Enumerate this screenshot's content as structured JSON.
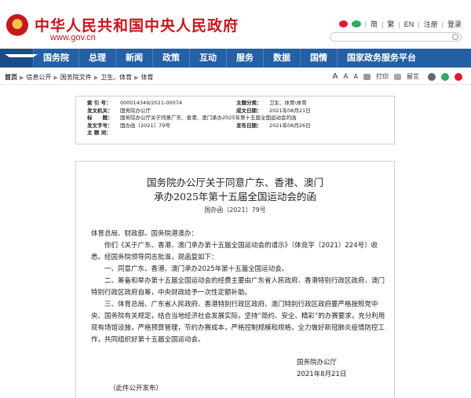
{
  "header": {
    "site_title": "中华人民共和国中央人民政府",
    "site_url": "www.gov.cn",
    "top_links": [
      "简",
      "繁",
      "EN",
      "注册",
      "登录"
    ]
  },
  "nav": {
    "items": [
      "国务院",
      "总理",
      "新闻",
      "政策",
      "互动",
      "服务",
      "数据",
      "国情",
      "国家政务服务平台"
    ]
  },
  "breadcrumb": {
    "items": [
      "首页",
      "信息公开",
      "国务院文件",
      "卫生、体育",
      "体育"
    ],
    "tools": [
      "A",
      "A",
      "A",
      "打印",
      "留言"
    ]
  },
  "meta": {
    "index_label": "索 引 号：",
    "index_value": "000014349/2021-00074",
    "category_label": "主题分类：",
    "category_value": "卫生、体育\\体育",
    "issuer_label": "发文机关：",
    "issuer_value": "国务院办公厅",
    "created_label": "成文日期：",
    "created_value": "2021年08月21日",
    "title_label": "标　　题：",
    "title_value": "国务院办公厅关于同意广东、香港、澳门承办2025年第十五届全国运动会的函",
    "docno_label": "发文字号：",
    "docno_value": "国办函〔2021〕79号",
    "published_label": "发布日期：",
    "published_value": "2021年08月26日",
    "keyword_label": "主 题 词："
  },
  "doc": {
    "title_line1": "国务院办公厅关于同意广东、香港、澳门",
    "title_line2": "承办2025年第十五届全国运动会的函",
    "doc_no": "国办函〔2021〕79号",
    "salutation": "体育总局、财政部、国务院港澳办：",
    "p1": "你们《关于广东、香港、澳门承办第十五届全国运动会的请示》（体竞字〔2021〕224号）收悉。经国务院领导同志批准，现函复如下：",
    "p2": "一、同意广东、香港、澳门承办2025年第十五届全国运动会。",
    "p3": "二、筹备和举办第十五届全国运动会的经费主要由广东省人民政府、香港特别行政区政府、澳门特别行政区政府自筹，中央财政给予一次性定额补助。",
    "p4": "三、体育总局、广东省人民政府、香港特别行政区政府、澳门特别行政区政府要严格按照党中央、国务院有关规定，结合当地经济社会发展实际，坚持“简约、安全、精彩”的办赛要求，充分利用现有场馆设施，严格预算管理，节约办赛成本，严格控制规模和规格，全力做好新冠肺炎疫情防控工作，共同组织好第十五届全国运动会。",
    "signer": "国务院办公厅",
    "date": "2021年8月21日",
    "note": "（此件公开发布）"
  },
  "colors": {
    "brand_red": "#c8161d",
    "nav_blue": "#2360a6"
  }
}
